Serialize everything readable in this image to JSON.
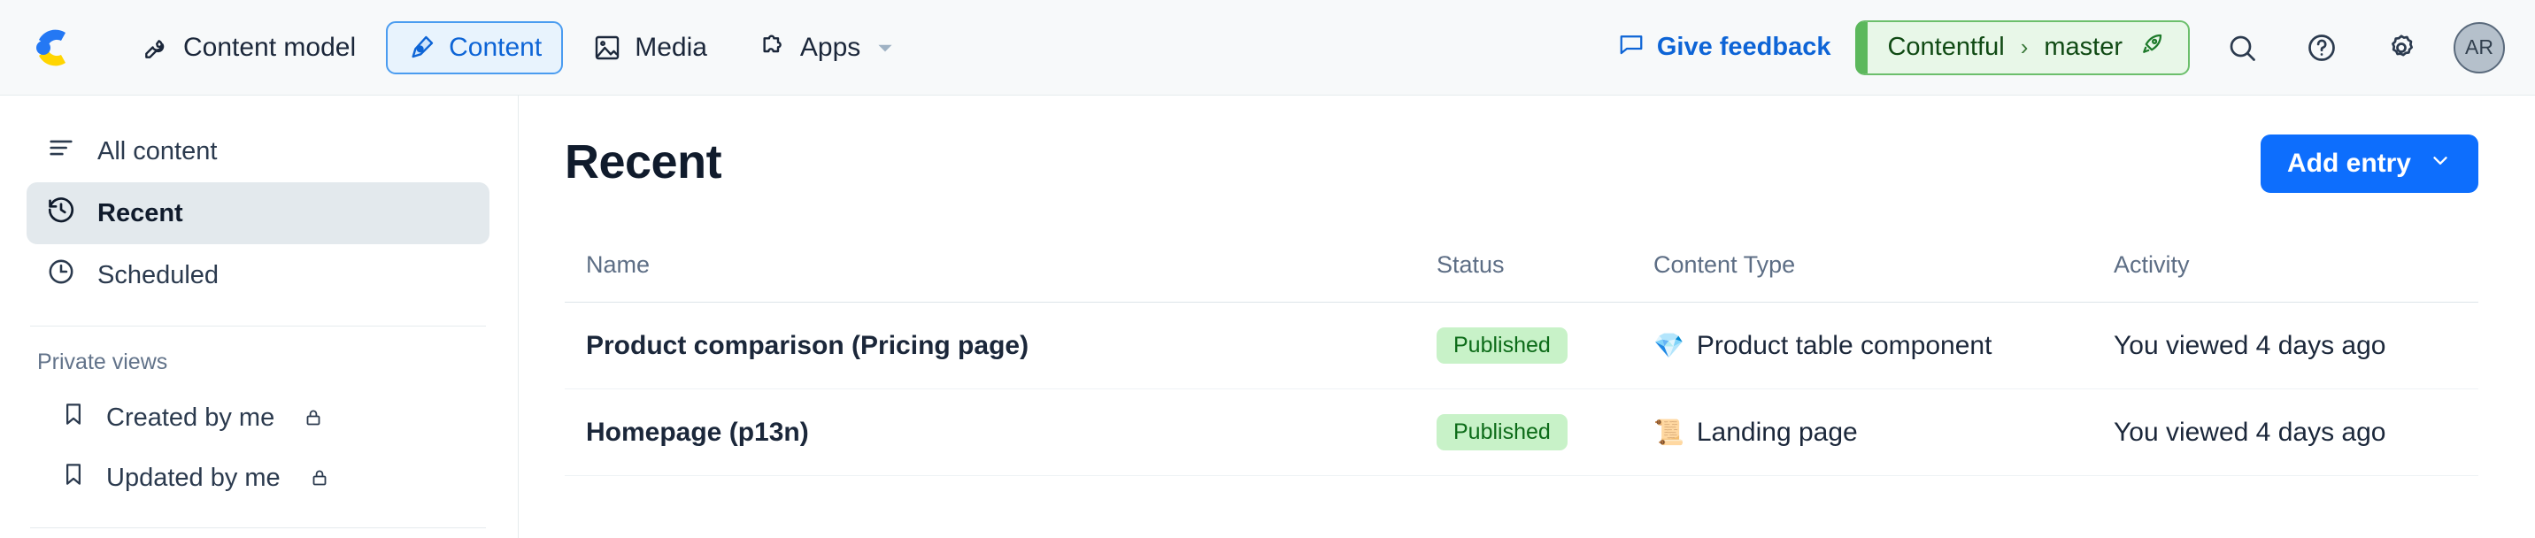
{
  "topnav": {
    "logo_name": "contentful-logo",
    "items": [
      {
        "label": "Content model",
        "icon": "wrench-icon",
        "active": false
      },
      {
        "label": "Content",
        "icon": "pen-nib-icon",
        "active": true
      },
      {
        "label": "Media",
        "icon": "image-icon",
        "active": false
      },
      {
        "label": "Apps",
        "icon": "puzzle-piece-icon",
        "active": false,
        "caret": true
      }
    ],
    "give_feedback": "Give feedback",
    "environment": {
      "space": "Contentful",
      "separator": "›",
      "branch": "master",
      "rocket_icon": "rocket-icon"
    },
    "actions": [
      {
        "name": "search-icon",
        "glyph": "search"
      },
      {
        "name": "help-icon",
        "glyph": "question"
      },
      {
        "name": "gear-icon",
        "glyph": "gear"
      }
    ],
    "avatar_initials": "AR"
  },
  "sidebar": {
    "items": [
      {
        "label": "All content",
        "icon": "list-lines-icon",
        "active": false
      },
      {
        "label": "Recent",
        "icon": "clock-rewind-icon",
        "active": true
      },
      {
        "label": "Scheduled",
        "icon": "clock-icon",
        "active": false
      }
    ],
    "section_title": "Private views",
    "private_views": [
      {
        "label": "Created by me",
        "icon": "bookmark-icon",
        "lock": "lock-icon"
      },
      {
        "label": "Updated by me",
        "icon": "bookmark-icon",
        "lock": "lock-icon"
      }
    ]
  },
  "main": {
    "title": "Recent",
    "add_entry_label": "Add entry",
    "add_entry_caret": "chevron-down-icon",
    "accent_color": "#0d6efd",
    "badge_color": "#c8f2c8",
    "table": {
      "headers": [
        "Name",
        "Status",
        "Content Type",
        "Activity"
      ],
      "rows": [
        {
          "name": "Product comparison (Pricing page)",
          "status": "Published",
          "type_emoji": "💎",
          "type": "Product table component",
          "activity": "You viewed 4 days ago"
        },
        {
          "name": "Homepage (p13n)",
          "status": "Published",
          "type_emoji": "📜",
          "type": "Landing page",
          "activity": "You viewed 4 days ago"
        }
      ]
    }
  }
}
